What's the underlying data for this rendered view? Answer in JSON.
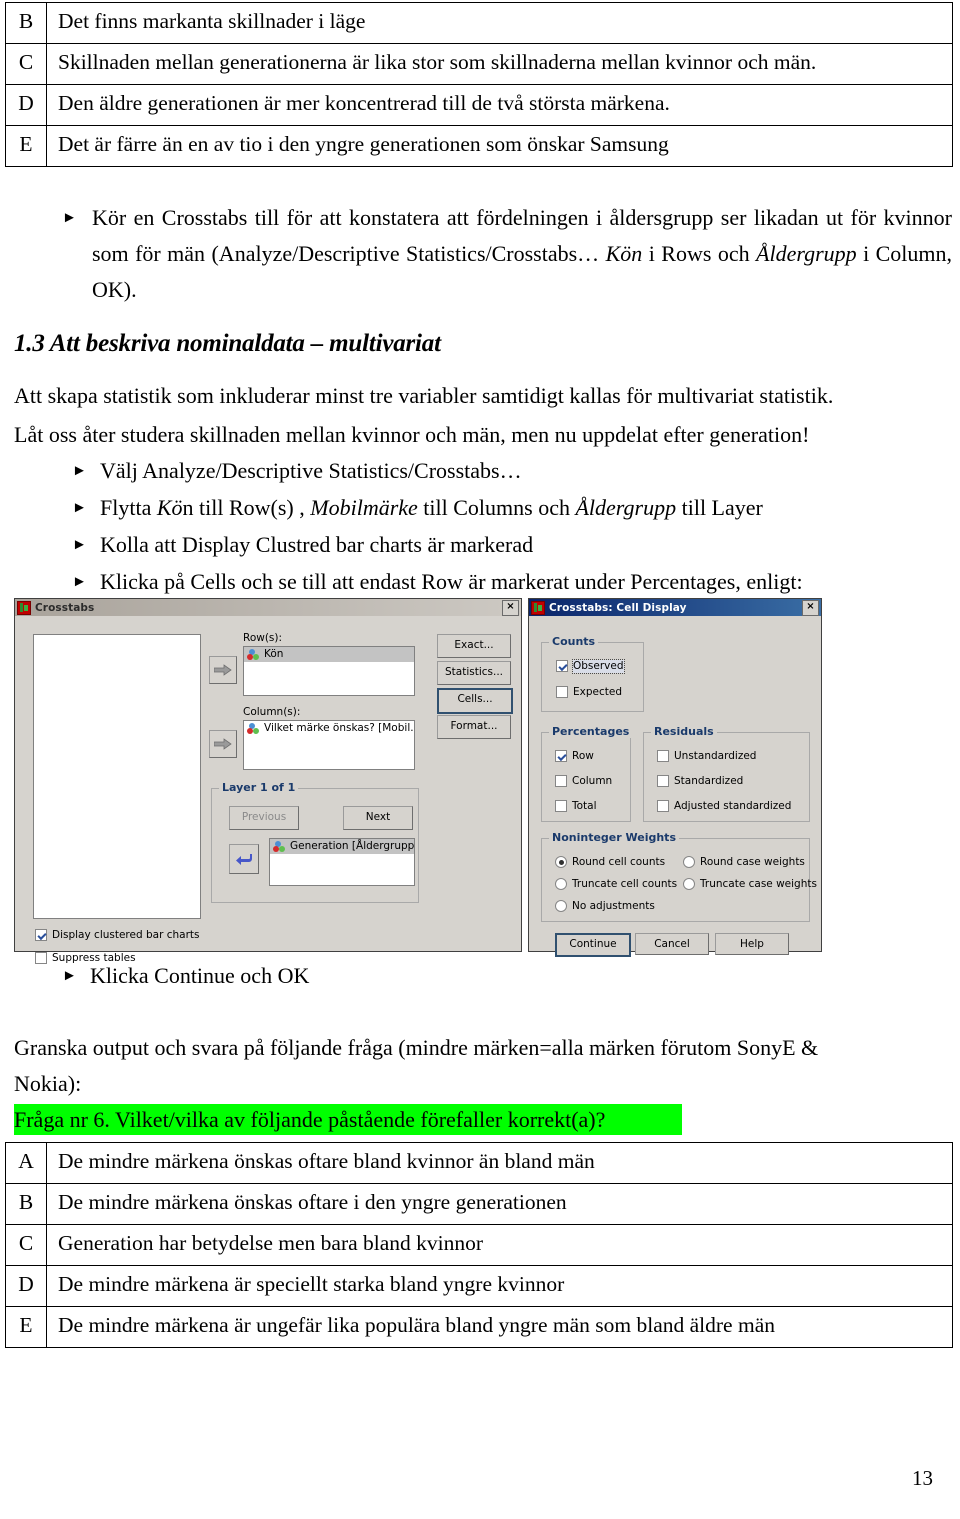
{
  "top_options": [
    {
      "letter": "B",
      "text": "Det finns markanta skillnader i läge"
    },
    {
      "letter": "C",
      "text": "Skillnaden mellan generationerna är lika stor som skillnaderna mellan kvinnor och män."
    },
    {
      "letter": "D",
      "text": "Den äldre generationen är mer koncentrerad till de två största märkena."
    },
    {
      "letter": "E",
      "text": "Det är färre än en av tio i den yngre generationen som önskar Samsung"
    }
  ],
  "instructions": {
    "crosstabs_bullet_part1": "Kör en Crosstabs till för att konstatera att fördelningen i åldersgrupp ser likadan ut för kvinnor som för män (Analyze/Descriptive Statistics/Crosstabs… ",
    "crosstabs_bullet_italic1": "Kön",
    "crosstabs_bullet_part2": " i Rows och ",
    "crosstabs_bullet_italic2": "Åldergrupp",
    "crosstabs_bullet_part3": " i Column, OK)."
  },
  "heading": "1.3 Att beskriva nominaldata – multivariat",
  "body": {
    "multivariat": "Att skapa statistik som inkluderar minst tre variabler samtidigt kallas för multivariat statistik.",
    "latoss": "Låt oss åter studera skillnaden mellan kvinnor och män, men nu uppdelat efter generation!"
  },
  "bullets": {
    "b1": "Välj Analyze/Descriptive Statistics/Crosstabs…",
    "b2_pre": "Flytta ",
    "b2_i1": "Kö",
    "b2_mid1": "n till Row(s) , ",
    "b2_i2": "Mobilmärke",
    "b2_mid2": " till Columns och ",
    "b2_i3": "Åldergrupp",
    "b2_end": " till Layer",
    "b3": "Kolla att Display Clustred bar charts är markerad",
    "b4": "Klicka på Cells och se till att endast Row är markerat under Percentages, enligt:",
    "b5": "Klicka Continue och OK"
  },
  "granska": {
    "line1": "Granska output och svara på följande fråga (mindre märken=alla märken förutom SonyE &",
    "line2": "Nokia):",
    "question": "Fråga nr 6. Vilket/vilka av följande påstående förefaller korrekt(a)?",
    "highlight_color": "#00ff00"
  },
  "bottom_options": [
    {
      "letter": "A",
      "text": "De mindre märkena önskas oftare bland kvinnor än bland män"
    },
    {
      "letter": "B",
      "text": "De mindre märkena önskas oftare i den yngre generationen"
    },
    {
      "letter": "C",
      "text": "Generation har betydelse men bara bland kvinnor"
    },
    {
      "letter": "D",
      "text": "De mindre märkena är speciellt starka bland yngre kvinnor"
    },
    {
      "letter": "E",
      "text": "De mindre märkena är ungefär lika populära bland yngre män som bland äldre män"
    }
  ],
  "page_number": "13",
  "crosstabs_dialog": {
    "title": "Crosstabs",
    "rows_label": "Row(s):",
    "rows_item": "Kön",
    "columns_label": "Column(s):",
    "columns_item": "Vilket märke önskas? [Mobil...",
    "layer_group": "Layer 1 of 1",
    "previous_button": "Previous",
    "next_button": "Next",
    "layer_item": "Generation [Åldergrupp]",
    "display_clustered": "Display clustered bar charts",
    "suppress_tables": "Suppress tables",
    "side_buttons": [
      "Exact...",
      "Statistics...",
      "Cells...",
      "Format..."
    ],
    "close_icon": "×"
  },
  "cell_dialog": {
    "title": "Crosstabs: Cell Display",
    "counts_group": "Counts",
    "counts": [
      {
        "label": "Observed",
        "checked": true
      },
      {
        "label": "Expected",
        "checked": false
      }
    ],
    "percentages_group": "Percentages",
    "percentages": [
      {
        "label": "Row",
        "checked": true
      },
      {
        "label": "Column",
        "checked": false
      },
      {
        "label": "Total",
        "checked": false
      }
    ],
    "residuals_group": "Residuals",
    "residuals": [
      {
        "label": "Unstandardized",
        "checked": false
      },
      {
        "label": "Standardized",
        "checked": false
      },
      {
        "label": "Adjusted standardized",
        "checked": false
      }
    ],
    "weights_group": "Noninteger Weights",
    "weights": [
      {
        "label": "Round cell counts",
        "selected": true
      },
      {
        "label": "Round case weights",
        "selected": false
      },
      {
        "label": "Truncate cell counts",
        "selected": false
      },
      {
        "label": "Truncate case weights",
        "selected": false
      },
      {
        "label": "No adjustments",
        "selected": false
      }
    ],
    "buttons": [
      "Continue",
      "Cancel",
      "Help"
    ],
    "close_icon": "×"
  }
}
